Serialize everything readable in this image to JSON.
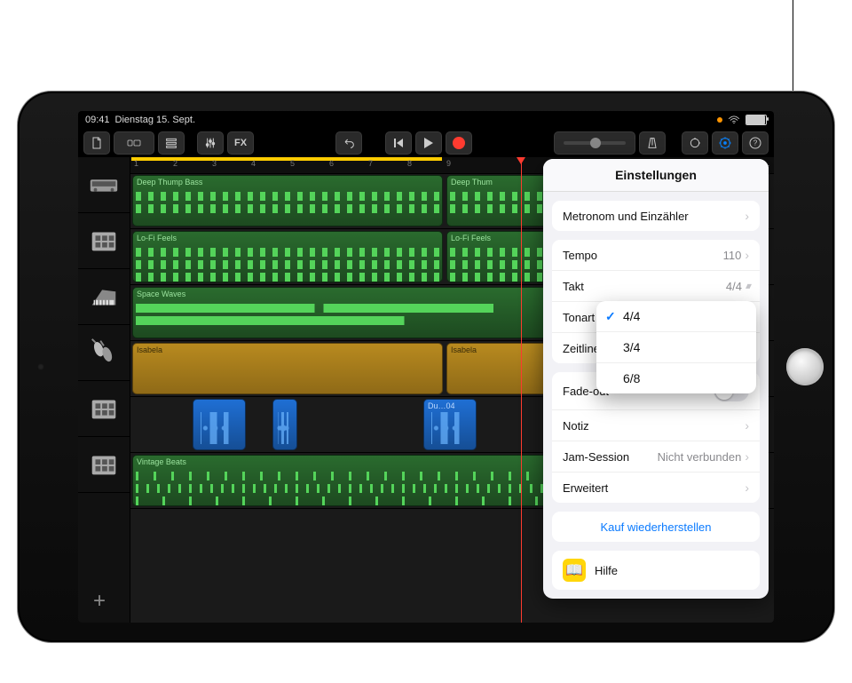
{
  "status": {
    "time": "09:41",
    "date": "Dienstag 15. Sept."
  },
  "toolbar": {
    "fx_label": "FX"
  },
  "tracks": [
    {
      "name": "Deep Thump Bass",
      "name2": "Deep Thum",
      "color": "green",
      "instrument": "synth"
    },
    {
      "name": "Lo-Fi Feels",
      "name2": "Lo-Fi Feels",
      "color": "green",
      "instrument": "drummachine"
    },
    {
      "name": "Space Waves",
      "name2": "",
      "color": "green",
      "instrument": "keys"
    },
    {
      "name": "Isabela",
      "name2": "Isabela",
      "color": "yellow",
      "instrument": "shaker"
    },
    {
      "name": "",
      "name2": "Du…04",
      "color": "blue",
      "instrument": "drummachine"
    },
    {
      "name": "Vintage Beats",
      "name2": "",
      "color": "green",
      "instrument": "drummachine"
    }
  ],
  "settings": {
    "title": "Einstellungen",
    "metronome": "Metronom und Einzähler",
    "tempo_label": "Tempo",
    "tempo_value": "110",
    "takt_label": "Takt",
    "takt_value": "4/4",
    "tonart_label": "Tonart",
    "zeitlineal_label": "Zeitlineal",
    "fadeout_label": "Fade-out",
    "notiz_label": "Notiz",
    "jam_label": "Jam-Session",
    "jam_value": "Nicht verbunden",
    "erweitert_label": "Erweitert",
    "restore_label": "Kauf wiederherstellen",
    "help_label": "Hilfe"
  },
  "takt_options": [
    "4/4",
    "3/4",
    "6/8"
  ],
  "takt_selected": "4/4"
}
